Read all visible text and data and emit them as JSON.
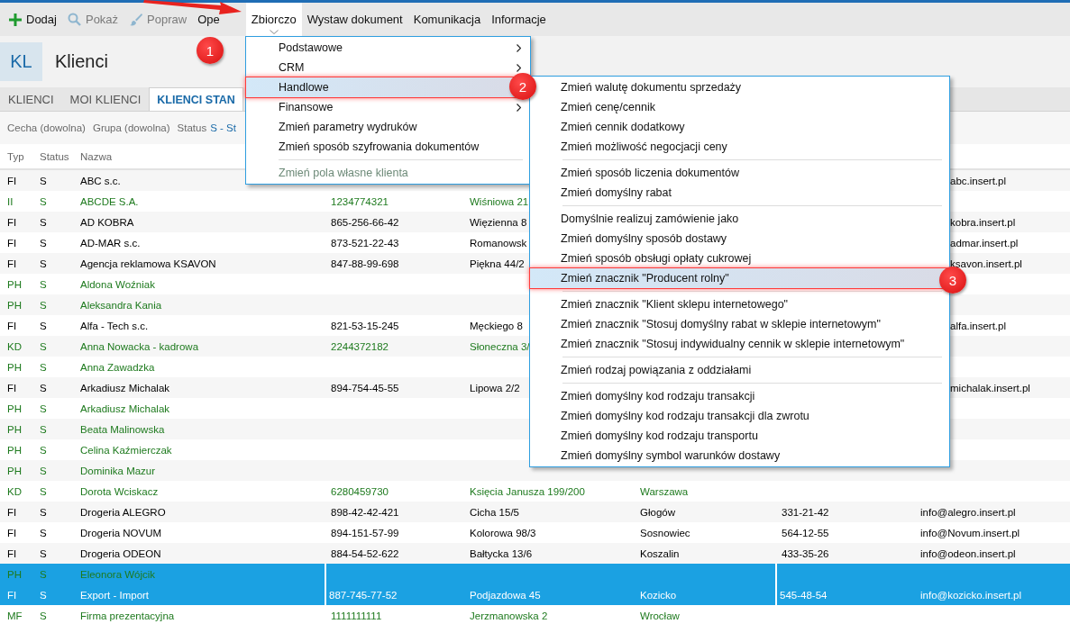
{
  "toolbar": {
    "items": [
      {
        "label": "Dodaj",
        "disabled": false,
        "selected": false
      },
      {
        "label": "Pokaż",
        "disabled": true,
        "selected": false
      },
      {
        "label": "Popraw",
        "disabled": true,
        "selected": false
      },
      {
        "label": "Ope",
        "disabled": false,
        "selected": false
      },
      {
        "label": "Zbiorczo",
        "disabled": false,
        "selected": true
      },
      {
        "label": "Wystaw dokument",
        "disabled": false,
        "selected": false
      },
      {
        "label": "Komunikacja",
        "disabled": false,
        "selected": false
      },
      {
        "label": "Informacje",
        "disabled": false,
        "selected": false
      }
    ]
  },
  "header": {
    "badge": "KL",
    "title": "Klienci"
  },
  "tabs": [
    {
      "label": "KLIENCI",
      "selected": false
    },
    {
      "label": "MOI KLIENCI",
      "selected": false
    },
    {
      "label": "KLIENCI STAN",
      "selected": true
    }
  ],
  "filters": {
    "items": [
      "Cecha (dowolna)",
      "Grupa (dowolna)"
    ],
    "status": {
      "label": "Status",
      "value": "S - St"
    }
  },
  "table": {
    "columns": [
      "Typ",
      "Status",
      "Nazwa"
    ],
    "rows": [
      {
        "typ": "FI",
        "status": "S",
        "name": "ABC s.c.",
        "email_tail": "abc.insert.pl",
        "color": "#000000",
        "selected": false
      },
      {
        "typ": "II",
        "status": "S",
        "name": "ABCDE S.A.",
        "nip": "1234774321",
        "street": "Wiśniowa 21",
        "color": "#1e7a1e",
        "selected": false
      },
      {
        "typ": "FI",
        "status": "S",
        "name": "AD KOBRA",
        "nip": "865-256-66-42",
        "street": "Więzienna 8",
        "email_tail": "kobra.insert.pl",
        "color": "#000000",
        "selected": false
      },
      {
        "typ": "FI",
        "status": "S",
        "name": "AD-MAR s.c.",
        "nip": "873-521-22-43",
        "street": "Romanowsk",
        "email_tail": "admar.insert.pl",
        "color": "#000000",
        "selected": false
      },
      {
        "typ": "FI",
        "status": "S",
        "name": "Agencja reklamowa KSAVON",
        "nip": "847-88-99-698",
        "street": "Piękna 44/2",
        "email_tail": "ksavon.insert.pl",
        "color": "#000000",
        "selected": false
      },
      {
        "typ": "PH",
        "status": "S",
        "name": "Aldona Woźniak",
        "color": "#1e7a1e",
        "selected": false
      },
      {
        "typ": "PH",
        "status": "S",
        "name": "Aleksandra Kania",
        "color": "#1e7a1e",
        "selected": false
      },
      {
        "typ": "FI",
        "status": "S",
        "name": "Alfa - Tech s.c.",
        "nip": "821-53-15-245",
        "street": "Męckiego 8",
        "email_tail": "alfa.insert.pl",
        "color": "#000000",
        "selected": false
      },
      {
        "typ": "KD",
        "status": "S",
        "name": "Anna Nowacka - kadrowa",
        "nip": "2244372182",
        "street": "Słoneczna 3/",
        "color": "#1e7a1e",
        "selected": false
      },
      {
        "typ": "PH",
        "status": "S",
        "name": "Anna Zawadzka",
        "color": "#1e7a1e",
        "selected": false
      },
      {
        "typ": "FI",
        "status": "S",
        "name": "Arkadiusz Michalak",
        "nip": "894-754-45-55",
        "street": "Lipowa 2/2",
        "email_tail": "michalak.insert.pl",
        "color": "#000000",
        "selected": false
      },
      {
        "typ": "PH",
        "status": "S",
        "name": "Arkadiusz Michalak",
        "color": "#1e7a1e",
        "selected": false
      },
      {
        "typ": "PH",
        "status": "S",
        "name": "Beata Malinowska",
        "color": "#1e7a1e",
        "selected": false
      },
      {
        "typ": "PH",
        "status": "S",
        "name": "Celina Kaźmierczak",
        "color": "#1e7a1e",
        "selected": false
      },
      {
        "typ": "PH",
        "status": "S",
        "name": "Dominika Mazur",
        "color": "#1e7a1e",
        "selected": false
      },
      {
        "typ": "KD",
        "status": "S",
        "name": "Dorota Wciskacz",
        "nip": "6280459730",
        "street": "Księcia Janusza 199/200",
        "city": "Warszawa",
        "color": "#1e7a1e",
        "selected": false
      },
      {
        "typ": "FI",
        "status": "S",
        "name": "Drogeria ALEGRO",
        "nip": "898-42-42-421",
        "street": "Cicha  15/5",
        "city": "Głogów",
        "phone": "331-21-42",
        "email": "info@alegro.insert.pl",
        "color": "#000000",
        "selected": false
      },
      {
        "typ": "FI",
        "status": "S",
        "name": "Drogeria NOVUM",
        "nip": "894-151-57-99",
        "street": "Kolorowa  98/3",
        "city": "Sosnowiec",
        "phone": "564-12-55",
        "email": "info@Novum.insert.pl",
        "color": "#000000",
        "selected": false
      },
      {
        "typ": "FI",
        "status": "S",
        "name": "Drogeria ODEON",
        "nip": "884-54-52-622",
        "street": "Bałtycka  13/6",
        "city": "Koszalin",
        "phone": "433-35-26",
        "email": "info@odeon.insert.pl",
        "color": "#000000",
        "selected": false
      },
      {
        "typ": "PH",
        "status": "S",
        "name": "Eleonora Wójcik",
        "color": "#1e7a1e",
        "selected": true
      },
      {
        "typ": "FI",
        "status": "S",
        "name": "Export - Import",
        "nip": "887-745-77-52",
        "street": "Podjazdowa 45",
        "city": "Kozicko",
        "phone": "545-48-54",
        "email": "info@kozicko.insert.pl",
        "color": "#ffffff",
        "selected": true
      },
      {
        "typ": "MF",
        "status": "S",
        "name": "Firma prezentacyjna",
        "nip": "1111111111",
        "street": "Jerzmanowska 2",
        "city": "Wrocław",
        "color": "#1e7a1e",
        "selected": false
      }
    ]
  },
  "menu": {
    "groups": [
      [
        {
          "label": "Podstawowe",
          "has_submenu": true,
          "selected": false,
          "disabled": false
        },
        {
          "label": "CRM",
          "has_submenu": true,
          "selected": false,
          "disabled": false
        },
        {
          "label": "Handlowe",
          "has_submenu": false,
          "selected": true,
          "disabled": false
        },
        {
          "label": "Finansowe",
          "has_submenu": true,
          "selected": false,
          "disabled": false
        },
        {
          "label": "Zmień parametry wydruków",
          "has_submenu": false,
          "selected": false,
          "disabled": false
        },
        {
          "label": "Zmień sposób szyfrowania dokumentów",
          "has_submenu": false,
          "selected": false,
          "disabled": false
        }
      ],
      [
        {
          "label": "Zmień pola własne klienta",
          "has_submenu": false,
          "selected": false,
          "disabled": true
        }
      ]
    ]
  },
  "submenu": {
    "groups": [
      [
        {
          "label": "Zmień walutę dokumentu sprzedaży",
          "selected": false
        },
        {
          "label": "Zmień cenę/cennik",
          "selected": false
        },
        {
          "label": "Zmień cennik dodatkowy",
          "selected": false
        },
        {
          "label": "Zmień możliwość negocjacji ceny",
          "selected": false
        }
      ],
      [
        {
          "label": "Zmień sposób liczenia dokumentów",
          "selected": false
        },
        {
          "label": "Zmień domyślny rabat",
          "selected": false
        }
      ],
      [
        {
          "label": "Domyślnie realizuj zamówienie jako",
          "selected": false
        },
        {
          "label": "Zmień domyślny sposób dostawy",
          "selected": false
        },
        {
          "label": "Zmień sposób obsługi opłaty cukrowej",
          "selected": false
        },
        {
          "label": "Zmień znacznik \"Producent rolny\"",
          "selected": true
        }
      ],
      [
        {
          "label": "Zmień znacznik \"Klient sklepu internetowego\"",
          "selected": false
        },
        {
          "label": "Zmień znacznik \"Stosuj domyślny rabat w sklepie internetowym\"",
          "selected": false
        },
        {
          "label": "Zmień znacznik \"Stosuj indywidualny cennik w sklepie internetowym\"",
          "selected": false
        }
      ],
      [
        {
          "label": "Zmień rodzaj powiązania z oddziałami",
          "selected": false
        }
      ],
      [
        {
          "label": "Zmień domyślny kod rodzaju transakcji",
          "selected": false
        },
        {
          "label": "Zmień domyślny kod rodzaju transakcji dla zwrotu",
          "selected": false
        },
        {
          "label": "Zmień domyślny kod rodzaju transportu",
          "selected": false
        },
        {
          "label": "Zmień domyślny symbol warunków dostawy",
          "selected": false
        }
      ]
    ]
  },
  "annotations": {
    "badges": [
      "1",
      "2",
      "3"
    ]
  }
}
